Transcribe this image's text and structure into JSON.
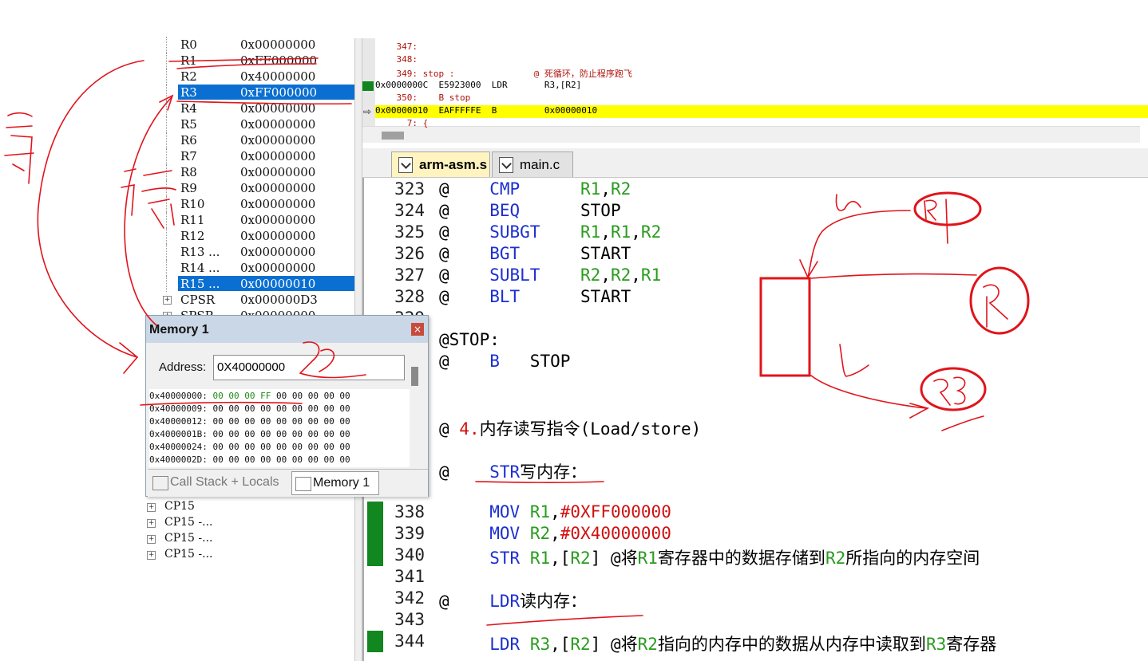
{
  "registers": [
    {
      "name": "R0",
      "value": "0x00000000"
    },
    {
      "name": "R1",
      "value": "0xFF000000"
    },
    {
      "name": "R2",
      "value": "0x40000000"
    },
    {
      "name": "R3",
      "value": "0xFF000000",
      "selected": true
    },
    {
      "name": "R4",
      "value": "0x00000000"
    },
    {
      "name": "R5",
      "value": "0x00000000"
    },
    {
      "name": "R6",
      "value": "0x00000000"
    },
    {
      "name": "R7",
      "value": "0x00000000"
    },
    {
      "name": "R8",
      "value": "0x00000000"
    },
    {
      "name": "R9",
      "value": "0x00000000"
    },
    {
      "name": "R10",
      "value": "0x00000000"
    },
    {
      "name": "R11",
      "value": "0x00000000"
    },
    {
      "name": "R12",
      "value": "0x00000000"
    },
    {
      "name": "R13 ...",
      "value": "0x00000000"
    },
    {
      "name": "R14 ...",
      "value": "0x00000000"
    },
    {
      "name": "R15 ...",
      "value": "0x00000010",
      "selected": true
    },
    {
      "name": "CPSR",
      "value": "0x000000D3",
      "expander": true
    },
    {
      "name": "SPSR",
      "value": "0x00000000",
      "expander": true
    }
  ],
  "cp_tree": [
    "CP15",
    "CP15 -...",
    "CP15 -...",
    "CP15 -..."
  ],
  "disassembly": [
    {
      "type": "src",
      "text": "    347:"
    },
    {
      "type": "src",
      "text": "    348:"
    },
    {
      "type": "src",
      "text": "    349: stop :               @ 死循环，防止程序跑飞"
    },
    {
      "type": "ins",
      "text": "0x0000000C  E5923000  LDR       R3,[R2]",
      "mark": true
    },
    {
      "type": "src",
      "text": "    350:    B stop"
    },
    {
      "type": "cur",
      "text": "0x00000010  EAFFFFFE  B         0x00000010",
      "arrow": true
    },
    {
      "type": "src",
      "text": "      7: {"
    }
  ],
  "tabs": [
    {
      "label": "arm-asm.s",
      "active": true
    },
    {
      "label": "main.c",
      "active": false
    }
  ],
  "code_lines": [
    {
      "ln": "323",
      "text": "@    CMP      R1,R2"
    },
    {
      "ln": "324",
      "text": "@    BEQ      STOP"
    },
    {
      "ln": "325",
      "text": "@    SUBGT    R1,R1,R2"
    },
    {
      "ln": "326",
      "text": "@    BGT      START"
    },
    {
      "ln": "327",
      "text": "@    SUBLT    R2,R2,R1"
    },
    {
      "ln": "328",
      "text": "@    BLT      START"
    },
    {
      "ln": "329",
      "text": ""
    },
    {
      "ln": "330",
      "text": "@STOP:"
    },
    {
      "ln": "331",
      "text": "@    B   STOP"
    },
    {
      "ln": "332",
      "text": ""
    },
    {
      "ln": "333",
      "text": ""
    },
    {
      "ln": "334",
      "text": "@ 4.内存读写指令(Load/store)"
    },
    {
      "ln": "335",
      "text": ""
    },
    {
      "ln": "336",
      "text": "@    STR写内存："
    },
    {
      "ln": "337",
      "text": ""
    },
    {
      "ln": "338",
      "text": "     MOV R1,#0XFF000000",
      "mark": true
    },
    {
      "ln": "339",
      "text": "     MOV R2,#0X40000000",
      "mark": true
    },
    {
      "ln": "340",
      "text": "     STR R1,[R2] @将R1寄存器中的数据存储到R2所指向的内存空间",
      "mark": true
    },
    {
      "ln": "341",
      "text": ""
    },
    {
      "ln": "342",
      "text": "@    LDR读内存："
    },
    {
      "ln": "343",
      "text": ""
    },
    {
      "ln": "344",
      "text": "     LDR R3,[R2] @将R2指向的内存中的数据从内存中读取到R3寄存器",
      "mark": true
    }
  ],
  "memory_window": {
    "title": "Memory 1",
    "close": "×",
    "address_label": "Address:",
    "address_value": "0X40000000",
    "rows": [
      {
        "addr": "0x40000000:",
        "bytes": "00 00 00 FF 00 00 00 00 00",
        "highlight": "00 00 00 FF"
      },
      {
        "addr": "0x40000009:",
        "bytes": "00 00 00 00 00 00 00 00 00"
      },
      {
        "addr": "0x40000012:",
        "bytes": "00 00 00 00 00 00 00 00 00"
      },
      {
        "addr": "0x4000001B:",
        "bytes": "00 00 00 00 00 00 00 00 00"
      },
      {
        "addr": "0x40000024:",
        "bytes": "00 00 00 00 00 00 00 00 00"
      },
      {
        "addr": "0x4000002D:",
        "bytes": "00 00 00 00 00 00 00 00 00"
      }
    ],
    "tabs": [
      {
        "label": "Call Stack + Locals",
        "active": false
      },
      {
        "label": "Memory 1",
        "active": true
      }
    ]
  },
  "annotation_color": "#e0141b"
}
